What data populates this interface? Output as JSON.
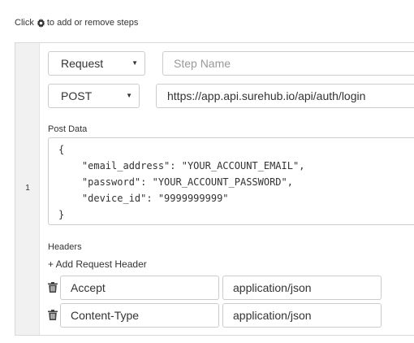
{
  "hint": {
    "prefix": "Click",
    "icon": "gear-icon",
    "suffix": "to add or remove steps"
  },
  "step": {
    "number": "1",
    "type_select": {
      "value": "Request"
    },
    "step_name": {
      "value": "",
      "placeholder": "Step Name"
    },
    "method_select": {
      "value": "POST"
    },
    "url": {
      "value": "https://app.api.surehub.io/api/auth/login"
    },
    "post_data": {
      "label": "Post Data",
      "lines": [
        "{",
        "    \"email_address\": \"YOUR_ACCOUNT_EMAIL\",",
        "    \"password\": \"YOUR_ACCOUNT_PASSWORD\",",
        "    \"device_id\": \"9999999999\"",
        "}"
      ]
    },
    "headers": {
      "label": "Headers",
      "add_label": "+ Add Request Header",
      "rows": [
        {
          "name": "Accept",
          "value": "application/json"
        },
        {
          "name": "Content-Type",
          "value": "application/json"
        }
      ]
    }
  }
}
